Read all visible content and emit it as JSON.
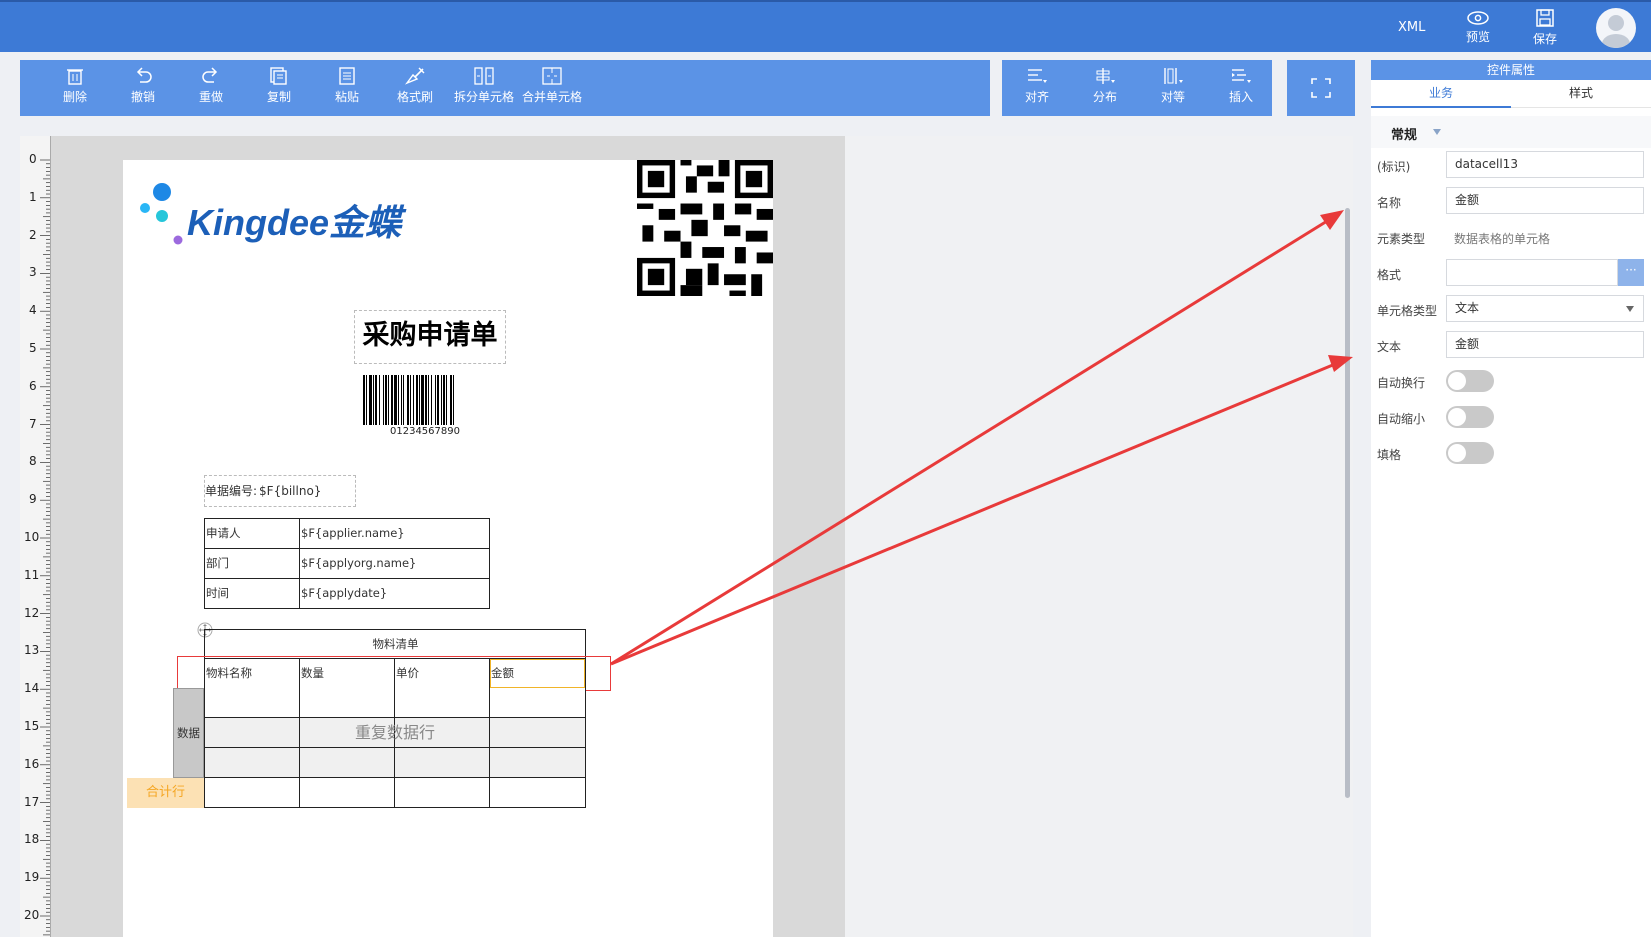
{
  "header": {
    "xml_label": "XML",
    "preview_label": "预览",
    "save_label": "保存"
  },
  "toolbar": {
    "edit": [
      "删除",
      "撤销",
      "重做",
      "复制",
      "粘贴",
      "格式刷",
      "拆分单元格",
      "合并单元格"
    ],
    "layout": [
      "对齐",
      "分布",
      "对等",
      "插入"
    ]
  },
  "ruler": [
    "0",
    "1",
    "2",
    "3",
    "4",
    "5",
    "6",
    "7",
    "8",
    "9",
    "10",
    "11",
    "12",
    "13",
    "14",
    "15",
    "16",
    "17",
    "18",
    "19",
    "20"
  ],
  "document": {
    "logo_text": "Kingdee金蝶",
    "title": "采购申请单",
    "barcode_text": "01234567890",
    "billno_label": "单据编号:",
    "billno_value": "$F{billno}",
    "info_rows": [
      {
        "label": "申请人",
        "value": "$F{applier.name}"
      },
      {
        "label": "部门",
        "value": "$F{applyorg.name}"
      },
      {
        "label": "时间",
        "value": "$F{applydate}"
      }
    ],
    "table_title": "物料清单",
    "columns": [
      "物料名称",
      "数量",
      "单价",
      "金额"
    ],
    "data_label": "数据",
    "repeat_label": "重复数据行",
    "total_label": "合计行"
  },
  "panel": {
    "title": "控件属性",
    "tabs": [
      "业务",
      "样式"
    ],
    "section": "常规",
    "props": [
      {
        "label": "(标识)",
        "value": "datacell13"
      },
      {
        "label": "名称",
        "value": "金额"
      },
      {
        "label": "元素类型",
        "value": "数据表格的单元格"
      },
      {
        "label": "格式",
        "value": ""
      },
      {
        "label": "单元格类型",
        "value": "文本"
      },
      {
        "label": "文本",
        "value": "金额"
      }
    ],
    "toggles": [
      "自动换行",
      "自动缩小",
      "填格"
    ]
  },
  "colors": {
    "accent": "#3d7ad6",
    "toolbar": "#5b93e6",
    "annotation": "#e83a3a",
    "total_row": "#f5a623"
  }
}
